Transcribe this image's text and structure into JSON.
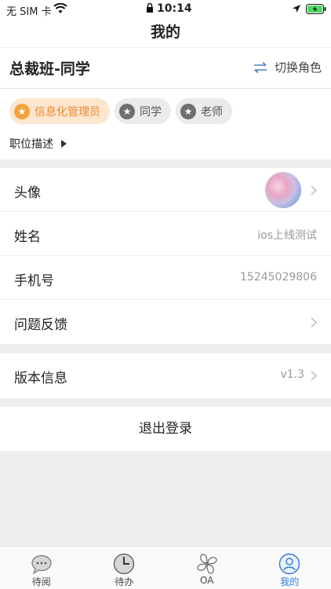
{
  "status_bar": {
    "carrier": "无 SIM 卡",
    "time": "10:14"
  },
  "nav": {
    "title": "我的"
  },
  "header": {
    "class_title": "总裁班-同学",
    "switch_role_label": "切换角色"
  },
  "roles": [
    {
      "label": "信息化管理员",
      "active": true
    },
    {
      "label": "同学",
      "active": false
    },
    {
      "label": "老师",
      "active": false
    }
  ],
  "job_description_label": "职位描述",
  "profile": {
    "avatar_label": "头像",
    "name_label": "姓名",
    "name_value": "ios上线测试",
    "phone_label": "手机号",
    "phone_value": "15245029806",
    "feedback_label": "问题反馈"
  },
  "version": {
    "label": "版本信息",
    "value": "v1.3"
  },
  "logout_label": "退出登录",
  "tabs": [
    {
      "label": "待阅",
      "icon": "chat-bubble-icon",
      "active": false
    },
    {
      "label": "待办",
      "icon": "clock-icon",
      "active": false
    },
    {
      "label": "OA",
      "icon": "clover-icon",
      "active": false
    },
    {
      "label": "我的",
      "icon": "user-icon",
      "active": true
    }
  ],
  "colors": {
    "accent": "#2f7bd8",
    "role_active_text": "#e98a2c",
    "role_active_bg": "#fde6cf"
  }
}
